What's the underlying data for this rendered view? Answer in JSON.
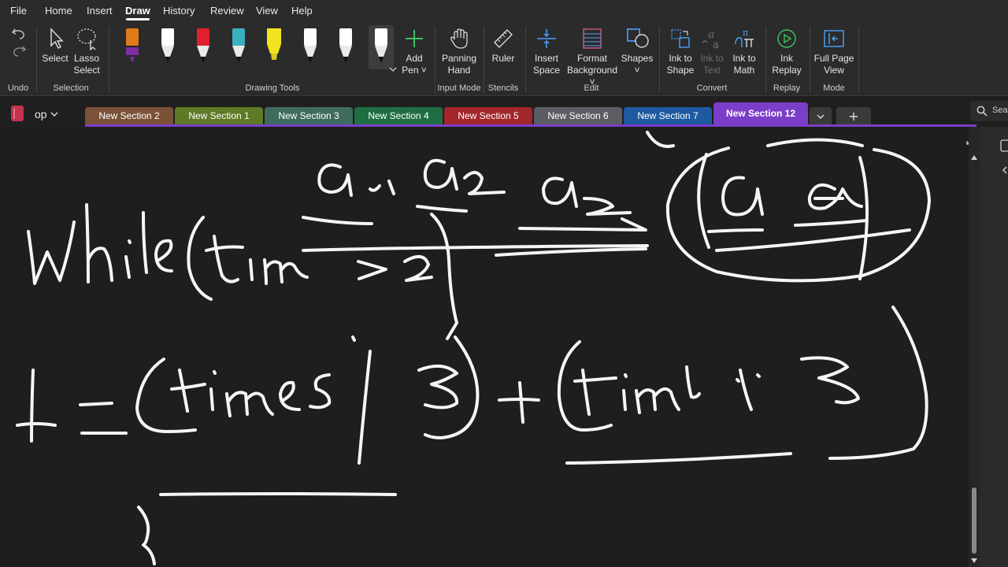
{
  "menu": {
    "items": [
      "File",
      "Home",
      "Insert",
      "Draw",
      "History",
      "Review",
      "View",
      "Help"
    ],
    "active": "Draw"
  },
  "ribbon": {
    "undo_group": "Undo",
    "selection": {
      "select": "Select",
      "lasso_1": "Lasso",
      "lasso_2": "Select",
      "group": "Selection"
    },
    "drawing_tools": {
      "group": "Drawing Tools",
      "add_pen_1": "Add",
      "add_pen_2": "Pen ˅",
      "pens": [
        {
          "color": "#e07b1a",
          "tip": "#7b2fa0"
        },
        {
          "color": "#ffffff",
          "tip": "#111111"
        },
        {
          "color": "#e0202a",
          "tip": "#111111"
        },
        {
          "color": "#3ab0c0",
          "tip": "#111111"
        },
        {
          "color": "#f2e321",
          "tip": "#f2e321"
        },
        {
          "color": "#ffffff",
          "tip": "#111111"
        },
        {
          "color": "#ffffff",
          "tip": "#111111"
        },
        {
          "color": "#ffffff",
          "tip": "#111111"
        }
      ]
    },
    "input_mode": {
      "panning_1": "Panning",
      "panning_2": "Hand",
      "group": "Input Mode"
    },
    "stencils": {
      "ruler": "Ruler",
      "group": "Stencils"
    },
    "edit": {
      "insert_1": "Insert",
      "insert_2": "Space",
      "format_1": "Format",
      "format_2": "Background ˅",
      "shapes_1": "Shapes",
      "shapes_2": "˅",
      "group": "Edit"
    },
    "convert": {
      "ink_shape_1": "Ink to",
      "ink_shape_2": "Shape",
      "ink_text_1": "Ink to",
      "ink_text_2": "Text",
      "ink_math_1": "Ink to",
      "ink_math_2": "Math",
      "group": "Convert"
    },
    "replay": {
      "label_1": "Ink",
      "label_2": "Replay",
      "group": "Replay"
    },
    "mode": {
      "label_1": "Full Page",
      "label_2": "View",
      "group": "Mode"
    }
  },
  "notebook": {
    "name": "op",
    "color": "#c4314b"
  },
  "tabs": [
    {
      "label": "New Section 2",
      "color": "#7a5238"
    },
    {
      "label": "New Section 1",
      "color": "#5e7a26"
    },
    {
      "label": "New Section 3",
      "color": "#3f6b5e"
    },
    {
      "label": "New Section 4",
      "color": "#1f6e43"
    },
    {
      "label": "New Section 5",
      "color": "#a3262c"
    },
    {
      "label": "New Section 6",
      "color": "#5c5c64"
    },
    {
      "label": "New Section 7",
      "color": "#1e5aa0"
    },
    {
      "label": "New Section 12",
      "color": "#7b3ec8"
    }
  ],
  "search": {
    "label": "Sea"
  }
}
